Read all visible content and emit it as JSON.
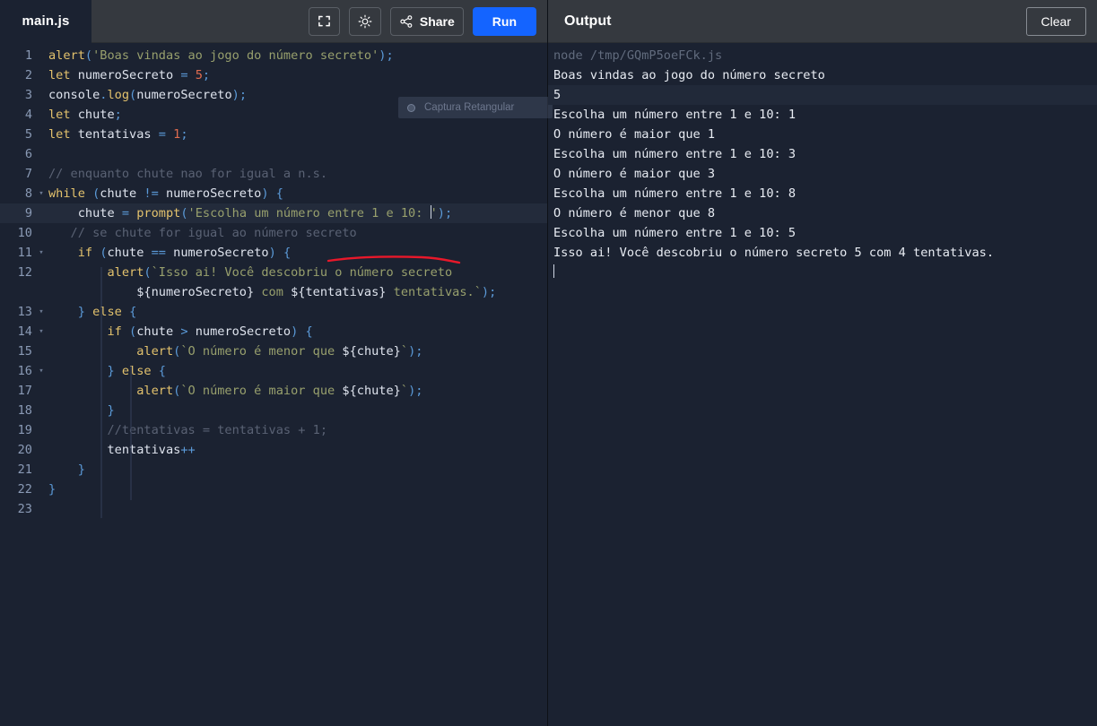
{
  "editor": {
    "tab_label": "main.js",
    "toolbar": {
      "fullscreen_icon": "fullscreen-icon",
      "theme_icon": "sun-brightness-icon",
      "share_icon": "share-nodes-icon",
      "share_label": "Share",
      "run_label": "Run"
    },
    "overlay": {
      "label": "Captura Retangular"
    },
    "lines": [
      {
        "n": "1",
        "fold": "",
        "text": "alert('Boas vindas ao jogo do número secreto');"
      },
      {
        "n": "2",
        "fold": "",
        "text": "let numeroSecreto = 5;"
      },
      {
        "n": "3",
        "fold": "",
        "text": "console.log(numeroSecreto);"
      },
      {
        "n": "4",
        "fold": "",
        "text": "let chute;"
      },
      {
        "n": "5",
        "fold": "",
        "text": "let tentativas = 1;"
      },
      {
        "n": "6",
        "fold": "",
        "text": ""
      },
      {
        "n": "7",
        "fold": "",
        "text": "// enquanto chute nao for igual a n.s."
      },
      {
        "n": "8",
        "fold": "▾",
        "text": "while (chute != numeroSecreto) {"
      },
      {
        "n": "9",
        "fold": "",
        "text": "    chute = prompt('Escolha um número entre 1 e 10: ');"
      },
      {
        "n": "10",
        "fold": "",
        "text": "   // se chute for igual ao número secreto"
      },
      {
        "n": "11",
        "fold": "▾",
        "text": "    if (chute == numeroSecreto) {"
      },
      {
        "n": "12",
        "fold": "",
        "text": "        alert(`Isso ai! Você descobriu o número secreto"
      },
      {
        "n": "",
        "fold": "",
        "text": "            ${numeroSecreto} com ${tentativas} tentativas.`);"
      },
      {
        "n": "13",
        "fold": "▾",
        "text": "    } else {"
      },
      {
        "n": "14",
        "fold": "▾",
        "text": "        if (chute > numeroSecreto) {"
      },
      {
        "n": "15",
        "fold": "",
        "text": "            alert(`O número é menor que ${chute}`);"
      },
      {
        "n": "16",
        "fold": "▾",
        "text": "        } else {"
      },
      {
        "n": "17",
        "fold": "",
        "text": "            alert(`O número é maior que ${chute}`);"
      },
      {
        "n": "18",
        "fold": "",
        "text": "        }"
      },
      {
        "n": "19",
        "fold": "",
        "text": "        //tentativas = tentativas + 1;"
      },
      {
        "n": "20",
        "fold": "",
        "text": "        tentativas++"
      },
      {
        "n": "21",
        "fold": "",
        "text": "    }"
      },
      {
        "n": "22",
        "fold": "",
        "text": "}"
      },
      {
        "n": "23",
        "fold": "",
        "text": ""
      }
    ]
  },
  "output": {
    "title": "Output",
    "clear_label": "Clear",
    "command": "node /tmp/GQmP5oeFCk.js",
    "lines": [
      "Boas vindas ao jogo do número secreto",
      "5",
      "Escolha um número entre 1 e 10: 1",
      "O número é maior que 1",
      "Escolha um número entre 1 e 10: 3",
      "O número é maior que 3",
      "Escolha um número entre 1 e 10: 8",
      "O número é menor que 8",
      "Escolha um número entre 1 e 10: 5",
      "Isso ai! Você descobriu o número secreto 5 com 4 tentativas."
    ],
    "annotation": {
      "kind": "red-underline-stroke",
      "color": "#e8182a",
      "targets": "com 4 tentativas."
    }
  },
  "colors": {
    "editor_bg": "#1b2231",
    "toolbar_bg": "#35393f",
    "run_blue": "#1464ff",
    "keyword": "#e3c26d",
    "string": "#98a06d",
    "number": "#e06c4f",
    "comment": "#5a6274",
    "punctuation": "#5b9ad8",
    "line_number": "#8a9ab5",
    "active_line": "#232b3b"
  }
}
